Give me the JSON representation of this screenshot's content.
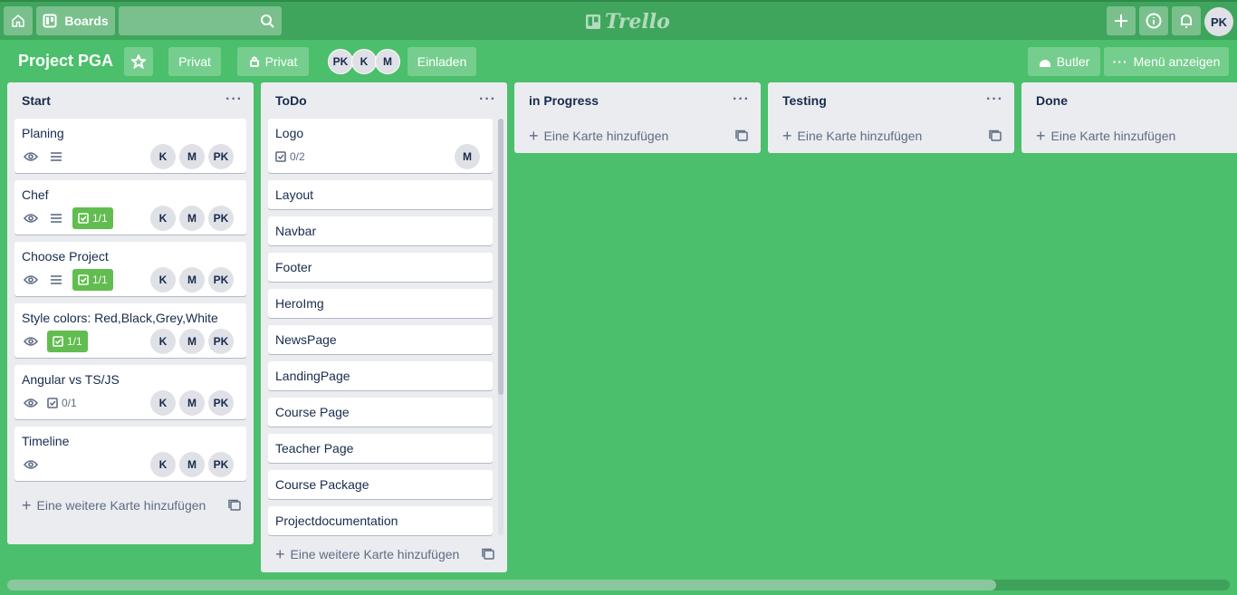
{
  "topbar": {
    "home_icon": "home-icon",
    "boards_label": "Boards",
    "search_placeholder": "",
    "logo_text": "Trello",
    "user_initials": "PK"
  },
  "board": {
    "title": "Project PGA",
    "visibility_team_label": "Privat",
    "visibility_label": "Privat",
    "members": [
      "PK",
      "K",
      "M"
    ],
    "invite_label": "Einladen",
    "butler_label": "Butler",
    "menu_label": "Menü anzeigen"
  },
  "lists": [
    {
      "title": "Start",
      "cards": [
        {
          "title": "Planing",
          "watch": true,
          "description": true,
          "checklist": null,
          "members": [
            "K",
            "M",
            "PK"
          ]
        },
        {
          "title": "Chef",
          "watch": true,
          "description": true,
          "checklist": "1/1",
          "checklist_complete": true,
          "members": [
            "K",
            "M",
            "PK"
          ]
        },
        {
          "title": "Choose Project",
          "watch": true,
          "description": true,
          "checklist": "1/1",
          "checklist_complete": true,
          "members": [
            "K",
            "M",
            "PK"
          ]
        },
        {
          "title": "Style colors: Red,Black,Grey,White",
          "watch": true,
          "description": false,
          "checklist": "1/1",
          "checklist_complete": true,
          "members": [
            "K",
            "M",
            "PK"
          ]
        },
        {
          "title": "Angular vs TS/JS",
          "watch": true,
          "description": false,
          "checklist": "0/1",
          "checklist_complete": false,
          "members": [
            "K",
            "M",
            "PK"
          ]
        },
        {
          "title": "Timeline",
          "watch": true,
          "description": false,
          "checklist": null,
          "members": [
            "K",
            "M",
            "PK"
          ]
        }
      ],
      "add_label": "Eine weitere Karte hinzufügen"
    },
    {
      "title": "ToDo",
      "cards": [
        {
          "title": "Logo",
          "checklist": "0/2",
          "members": [
            "M"
          ]
        },
        {
          "title": "Layout"
        },
        {
          "title": "Navbar"
        },
        {
          "title": "Footer"
        },
        {
          "title": "HeroImg"
        },
        {
          "title": "NewsPage"
        },
        {
          "title": "LandingPage"
        },
        {
          "title": "Course Page"
        },
        {
          "title": "Teacher Page"
        },
        {
          "title": "Course Package"
        },
        {
          "title": "Projectdocumentation"
        }
      ],
      "add_label": "Eine weitere Karte hinzufügen"
    },
    {
      "title": "in Progress",
      "cards": [],
      "add_label": "Eine Karte hinzufügen"
    },
    {
      "title": "Testing",
      "cards": [],
      "add_label": "Eine Karte hinzufügen"
    },
    {
      "title": "Done",
      "cards": [],
      "add_label": "Eine Karte hinzufügen"
    }
  ],
  "list_menu_glyph": "···",
  "colors": {
    "board_bg": "#4bbf6b",
    "topbar_bg": "#3fa55c",
    "list_bg": "#ebecf0",
    "checklist_complete": "#61bd4f"
  }
}
